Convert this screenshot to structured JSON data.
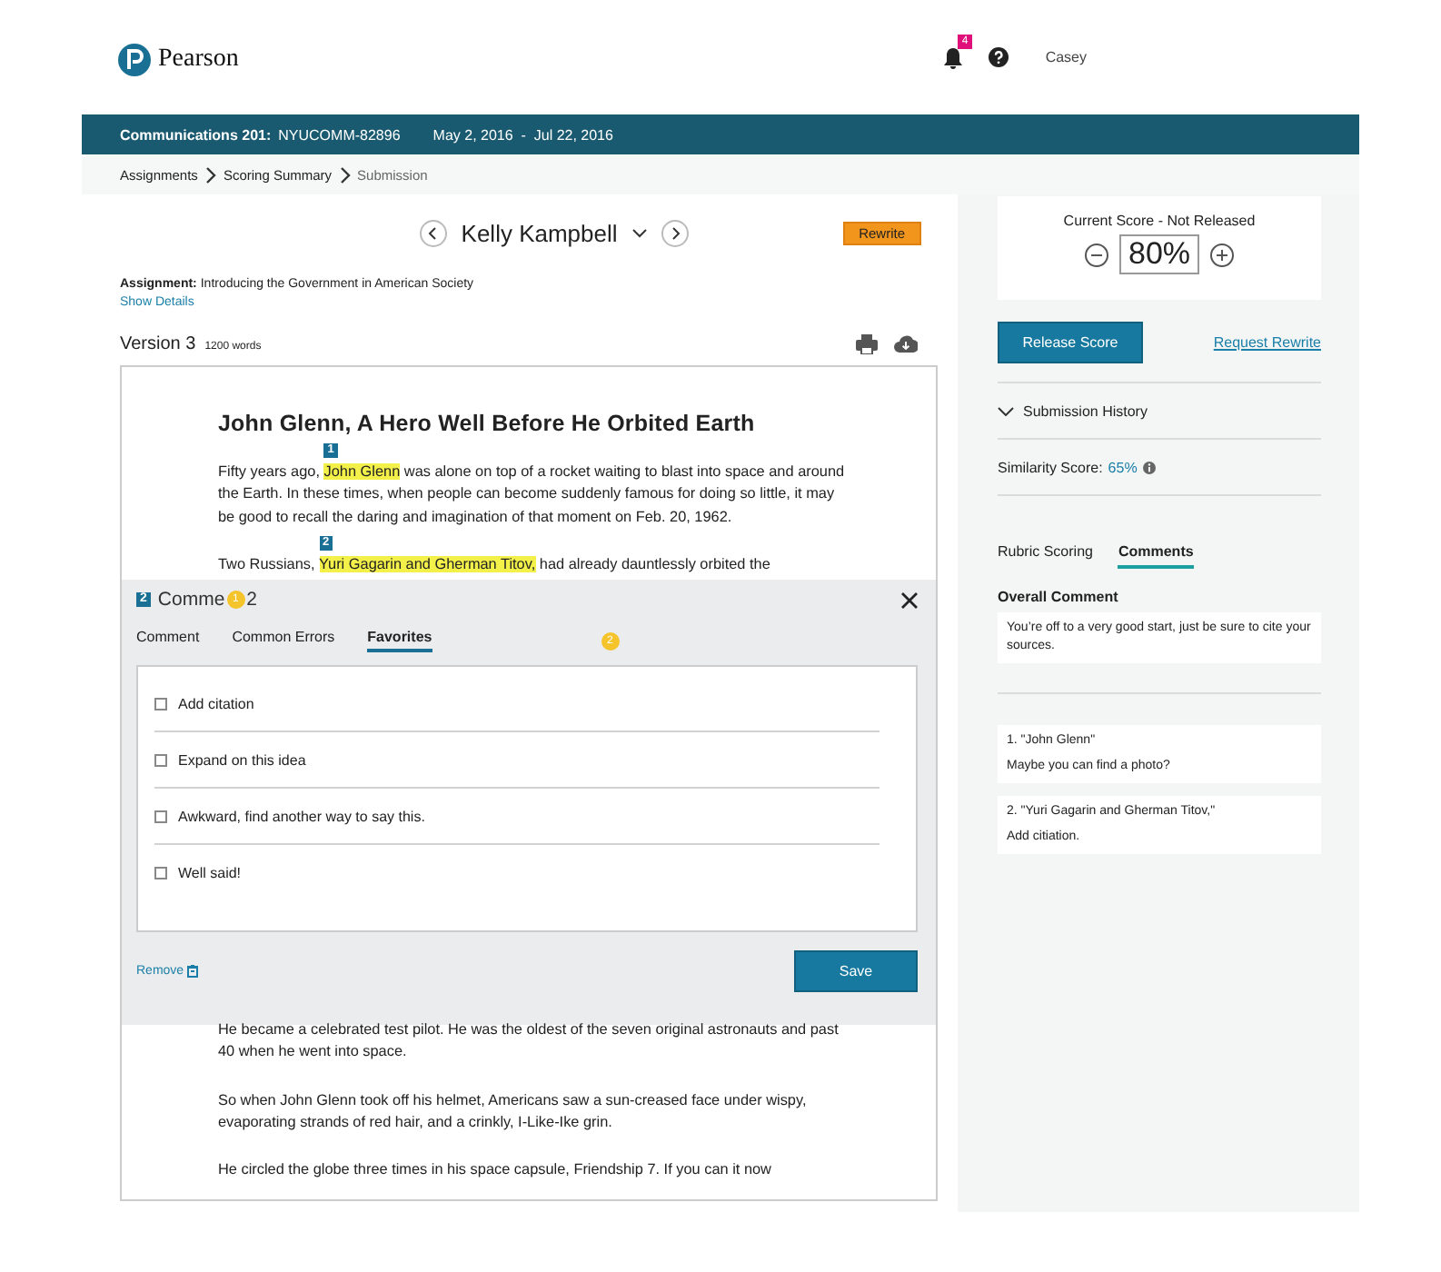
{
  "header": {
    "logo": "Pearson",
    "notification_count": "4",
    "user": "Casey"
  },
  "course_bar": {
    "course": "Communications 201:",
    "code": "NYUCOMM-82896",
    "dates": "May 2, 2016  -  Jul 22, 2016"
  },
  "breadcrumbs": [
    {
      "label": "Assignments",
      "current": false
    },
    {
      "label": "Scoring Summary",
      "current": false
    },
    {
      "label": "Submission",
      "current": true
    }
  ],
  "student": {
    "name": "Kelly Kampbell",
    "status": "Rewrite"
  },
  "assignment": {
    "label": "Assignment:",
    "title": "Introducing the Government in American Society",
    "link": "Show Details"
  },
  "version": {
    "title": "Version 3",
    "words": "1200 words"
  },
  "essay": {
    "title": "John Glenn, A Hero Well Before He Orbited Earth",
    "top_paragraphs": [
      [
        {
          "text": "Fifty years ago, "
        },
        {
          "text": "John Glenn",
          "marker": "1"
        },
        {
          "text": " was alone on top of a rocket waiting to blast into space and around the Earth. In these times, when people can become suddenly famous for doing so little, it may be good to recall the daring and imagination of that moment on Feb. 20, 1962."
        }
      ],
      [
        {
          "text": "Two Russians, "
        },
        {
          "text": "Yuri Gagarin and Gherman Titov,",
          "marker": "2"
        },
        {
          "text": " had already dauntlessly orbited the"
        }
      ]
    ],
    "bottom_paragraphs": [
      [
        {
          "text": "He became a celebrated test pilot. He was the oldest of the seven original astronauts and past 40 when he went into space."
        }
      ],
      [
        {
          "text": "So when John Glenn took off his helmet, Americans saw a sun-creased face under wispy, evaporating strands of red hair, and a crinkly, I-Like-Ike grin."
        }
      ],
      [
        {
          "text": "He circled the globe three times in his space capsule, Friendship 7. If you can it now"
        }
      ]
    ]
  },
  "comment_panel": {
    "marker": "2",
    "title_start": "Comme",
    "title_end": "2",
    "dots": [
      "1",
      "2"
    ],
    "tabs": [
      {
        "label": "Comment",
        "selected": false
      },
      {
        "label": "Common Errors",
        "selected": false
      },
      {
        "label": "Favorites",
        "selected": true
      }
    ],
    "favorites": [
      {
        "label": "Add citation",
        "checked": false
      },
      {
        "label": "Expand on this idea",
        "checked": false
      },
      {
        "label": "Awkward, find another way to say this.",
        "checked": false
      },
      {
        "label": "Well said!",
        "checked": false
      }
    ],
    "remove": "Remove",
    "save": "Save"
  },
  "score": {
    "label": "Current Score - Not Released",
    "value": "80%"
  },
  "actions": {
    "release": "Release Score",
    "request": "Request Rewrite"
  },
  "history": {
    "label": "Submission History"
  },
  "similarity": {
    "label": "Similarity Score:",
    "value": "65%"
  },
  "side_tabs": [
    {
      "label": "Rubric Scoring",
      "selected": false
    },
    {
      "label": "Comments",
      "selected": true
    }
  ],
  "overall": {
    "label": "Overall Comment",
    "text": "You’re off to a very good start, just be sure to cite your sources."
  },
  "comments": [
    {
      "title": "1. \"John Glenn\"",
      "text": "Maybe you can find a photo?"
    },
    {
      "title": "2. \"Yuri Gagarin and Gherman Titov,\"",
      "text": "Add citiation."
    }
  ]
}
